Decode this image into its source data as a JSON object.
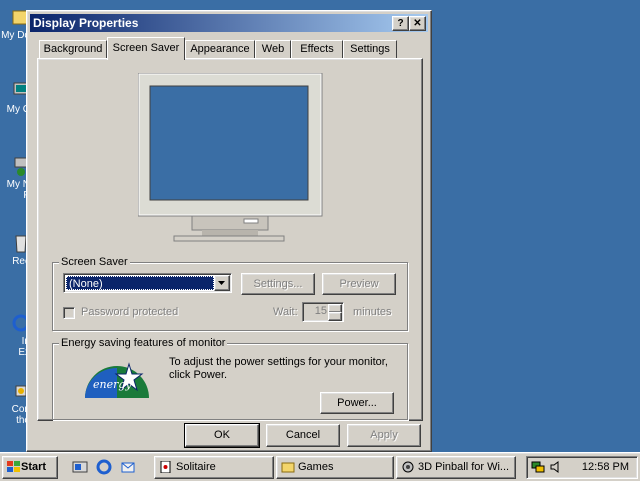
{
  "desktop": {
    "icons": [
      {
        "label": "My Do",
        "icon": "folder-icon"
      },
      {
        "label": "My C",
        "icon": "computer-icon"
      },
      {
        "label": "My N",
        "sublabel": "P",
        "icon": "network-icon"
      },
      {
        "label": "Rec",
        "icon": "recycle-bin-icon"
      },
      {
        "label": "In",
        "sublabel": "Ex",
        "icon": "internet-explorer-icon"
      },
      {
        "label": "Con",
        "sublabel": "the",
        "icon": "connect-icon"
      }
    ]
  },
  "window": {
    "title": "Display Properties",
    "help_label": "?",
    "close_label": "✕",
    "tabs": [
      {
        "label": "Background"
      },
      {
        "label": "Screen Saver"
      },
      {
        "label": "Appearance"
      },
      {
        "label": "Web"
      },
      {
        "label": "Effects"
      },
      {
        "label": "Settings"
      }
    ],
    "active_tab": "Screen Saver",
    "screen_saver_group": {
      "title": "Screen Saver",
      "selected": "(None)",
      "settings_label": "Settings...",
      "preview_label": "Preview",
      "password_label": "Password protected",
      "password_checked": false,
      "wait_label": "Wait:",
      "wait_value": "15",
      "minutes_label": "minutes"
    },
    "energy_group": {
      "title": "Energy saving features of monitor",
      "text": "To adjust the power settings for your monitor, click Power.",
      "power_label": "Power...",
      "logo_text": "energy"
    },
    "ok_label": "OK",
    "cancel_label": "Cancel",
    "apply_label": "Apply"
  },
  "taskbar": {
    "start_label": "Start",
    "tasks": [
      {
        "label": "Solitaire",
        "icon": "solitaire-icon"
      },
      {
        "label": "Games",
        "icon": "folder-icon"
      },
      {
        "label": "3D Pinball for Wi...",
        "icon": "pinball-icon"
      }
    ],
    "clock": "12:58 PM"
  },
  "colors": {
    "desktop": "#3a6ea5",
    "title_active": "#0a246a",
    "selection": "#0a246a",
    "face": "#d4d0c8"
  }
}
